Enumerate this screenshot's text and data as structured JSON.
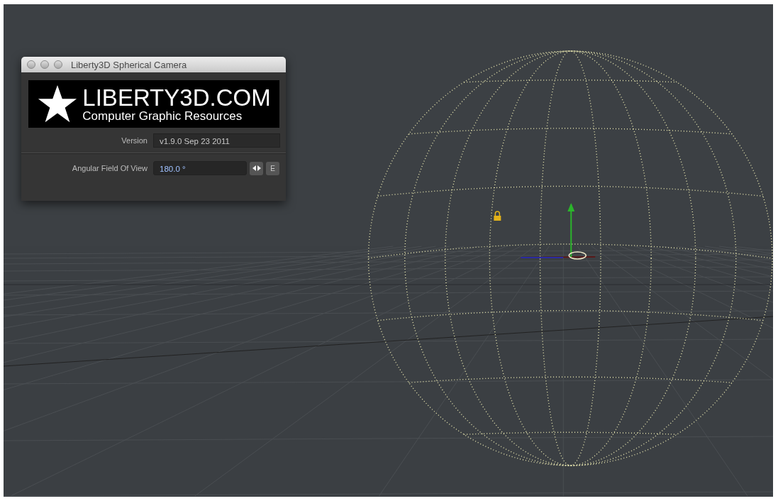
{
  "dialog": {
    "title": "Liberty3D Spherical Camera",
    "logo": {
      "title": "LIBERTY3D.COM",
      "subtitle": "Computer Graphic Resources"
    },
    "fields": [
      {
        "kind": "readonly",
        "label": "Version",
        "value": "v1.9.0 Sep 23 2011"
      },
      {
        "kind": "numeric",
        "label": "Angular Field Of View",
        "value": "180.0 °",
        "button": "E"
      }
    ]
  }
}
